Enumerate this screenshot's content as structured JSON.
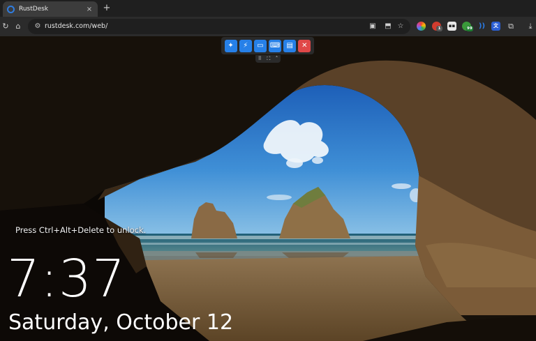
{
  "browser": {
    "tab": {
      "title": "RustDesk",
      "close_icon": "×"
    },
    "new_tab_icon": "+",
    "address": {
      "url": "rustdesk.com/web/"
    },
    "extensions": [
      {
        "name": "color-wheel-extension-icon",
        "color": "#c24ab8"
      },
      {
        "name": "red-extension-icon",
        "color": "#d13c2f",
        "badge": "1"
      },
      {
        "name": "dark-extension-icon",
        "color": "#3a3a3a"
      },
      {
        "name": "green-extension-icon",
        "color": "#3a9a3a",
        "badge": "99"
      },
      {
        "name": "audio-extension-icon",
        "color": "#2b7de9"
      },
      {
        "name": "translate-extension-icon",
        "color": "#2b5fd4"
      }
    ]
  },
  "remote_toolbar": {
    "buttons": [
      {
        "name": "pin-button",
        "icon": "pin-icon",
        "glyph": "✦"
      },
      {
        "name": "action-button",
        "icon": "lightning-icon",
        "glyph": "⚡"
      },
      {
        "name": "display-button",
        "icon": "monitor-icon",
        "glyph": "▭"
      },
      {
        "name": "keyboard-button",
        "icon": "keyboard-icon",
        "glyph": "⌨"
      },
      {
        "name": "chat-button",
        "icon": "chat-icon",
        "glyph": "▤"
      },
      {
        "name": "disconnect-button",
        "icon": "close-icon",
        "glyph": "✕"
      }
    ],
    "accent": "#2680e8",
    "close_color": "#e04848"
  },
  "lock_screen": {
    "hint": "Press Ctrl+Alt+Delete to unlock.",
    "time": "7:37",
    "date": "Saturday, October 12"
  }
}
